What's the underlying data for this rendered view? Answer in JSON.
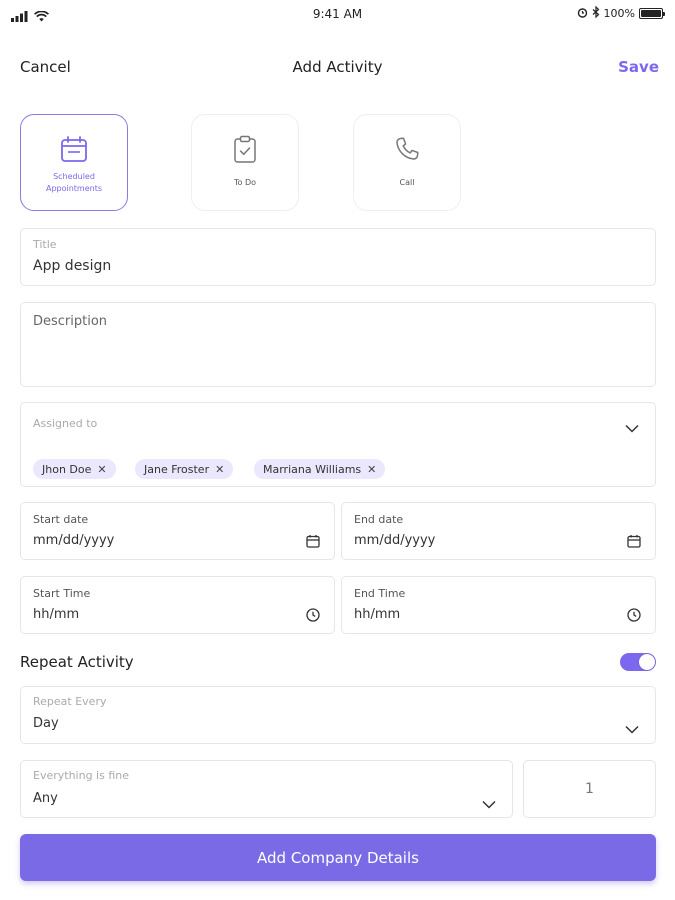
{
  "status_bar": {
    "time": "9:41 AM",
    "battery": "100%"
  },
  "nav": {
    "cancel_label": "Cancel",
    "title": "Add Activity",
    "save_label": "Save"
  },
  "activity_types": [
    {
      "label": "Scheduled Appointments",
      "icon": "calendar-icon",
      "selected": true
    },
    {
      "label": "To Do",
      "icon": "clipboard-check-icon",
      "selected": false
    },
    {
      "label": "Call",
      "icon": "phone-icon",
      "selected": false
    }
  ],
  "form": {
    "title": {
      "label": "Title",
      "value": "App design"
    },
    "description": {
      "placeholder": "Description"
    },
    "assigned": {
      "label": "Assigned to",
      "chips": [
        "Jhon Doe",
        "Jane Froster",
        "Marriana Williams"
      ]
    },
    "start_date": {
      "label": "Start date",
      "placeholder": "mm/dd/yyyy"
    },
    "end_date": {
      "label": "End date",
      "placeholder": "mm/dd/yyyy"
    },
    "start_time": {
      "label": "Start Time",
      "placeholder": "hh/mm"
    },
    "end_time": {
      "label": "End Time",
      "placeholder": "hh/mm"
    },
    "repeat_activity": {
      "label": "Repeat Activity",
      "enabled": true
    },
    "repeat_every": {
      "label": "Repeat Every",
      "value": "Day"
    },
    "everything": {
      "label": "Everything is fine",
      "value": "Any"
    },
    "count": {
      "value": "1"
    }
  },
  "primary_button": {
    "label": "Add Company Details"
  },
  "colors": {
    "accent": "#7b68ee",
    "chip_bg": "#ebe7fd",
    "border": "#e6e6e6"
  }
}
